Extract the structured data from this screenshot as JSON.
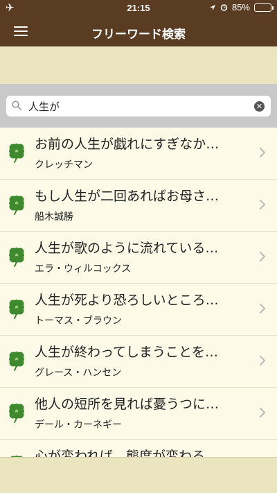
{
  "status_bar": {
    "time": "21:15",
    "battery": "85%",
    "battery_level": 0.85
  },
  "header": {
    "title": "フリーワード検索"
  },
  "search": {
    "value": "人生が"
  },
  "results": [
    {
      "quote": "お前の人生が戯れにすぎなか…",
      "author": "クレッチマン"
    },
    {
      "quote": "もし人生が二回あればお母さ…",
      "author": "船木誠勝"
    },
    {
      "quote": "人生が歌のように流れている…",
      "author": "エラ・ウィルコックス"
    },
    {
      "quote": "人生が死より恐ろしいところ…",
      "author": "トーマス・ブラウン"
    },
    {
      "quote": "人生が終わってしまうことを…",
      "author": "グレース・ハンセン"
    },
    {
      "quote": "他人の短所を見れば憂うつに…",
      "author": "デール・カーネギー"
    },
    {
      "quote": "心が変われば、態度が変わる…",
      "author": ""
    }
  ],
  "colors": {
    "header": "#5a3c23",
    "list_bg": "#fdfbe8",
    "banner": "#ebe5bf",
    "clover": "#3f8a2f"
  },
  "icons": {
    "menu": "hamburger-icon",
    "search": "magnifier-icon",
    "clear": "clear-circle-icon",
    "row": "four-leaf-clover-icon",
    "chevron": "chevron-right-icon"
  }
}
